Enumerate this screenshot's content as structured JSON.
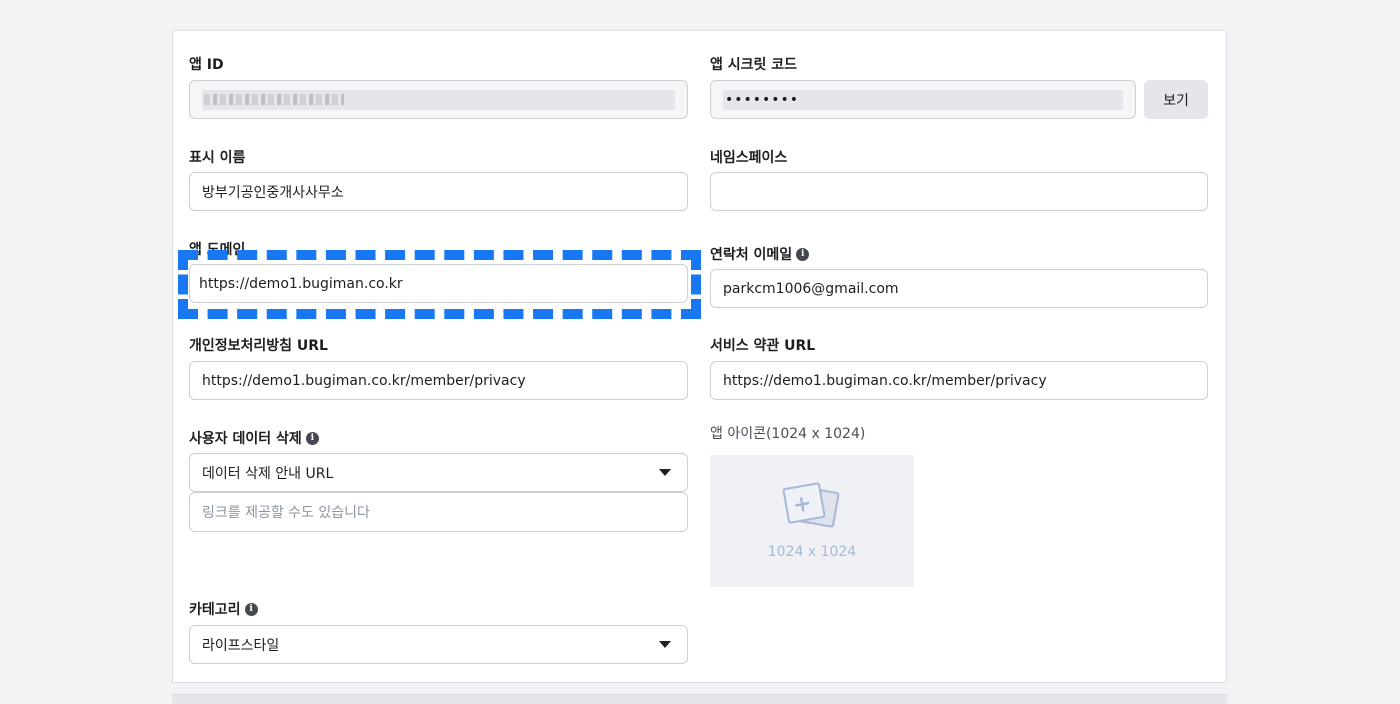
{
  "app_id": {
    "label": "앱 ID"
  },
  "app_secret": {
    "label": "앱 시크릿 코드",
    "value": "••••••••",
    "show_button": "보기"
  },
  "display_name": {
    "label": "표시 이름",
    "value": "방부기공인중개사사무소"
  },
  "namespace": {
    "label": "네임스페이스",
    "value": ""
  },
  "app_domain": {
    "label": "앱 도메인",
    "value": "https://demo1.bugiman.co.kr"
  },
  "contact_email": {
    "label": "연락처 이메일",
    "value": "parkcm1006@gmail.com"
  },
  "privacy_url": {
    "label": "개인정보처리방침 URL",
    "value": "https://demo1.bugiman.co.kr/member/privacy"
  },
  "terms_url": {
    "label": "서비스 약관 URL",
    "value": "https://demo1.bugiman.co.kr/member/privacy"
  },
  "data_deletion": {
    "label": "사용자 데이터 삭제",
    "selected": "데이터 삭제 안내 URL",
    "placeholder": "링크를 제공할 수도 있습니다"
  },
  "app_icon": {
    "label": "앱 아이콘(1024 x 1024)",
    "size_text": "1024 x 1024"
  },
  "category": {
    "label": "카테고리",
    "selected": "라이프스타일"
  },
  "colors": {
    "highlight": "#1877f2",
    "panel_bg": "#ffffff",
    "page_bg": "#f2f3f5"
  }
}
